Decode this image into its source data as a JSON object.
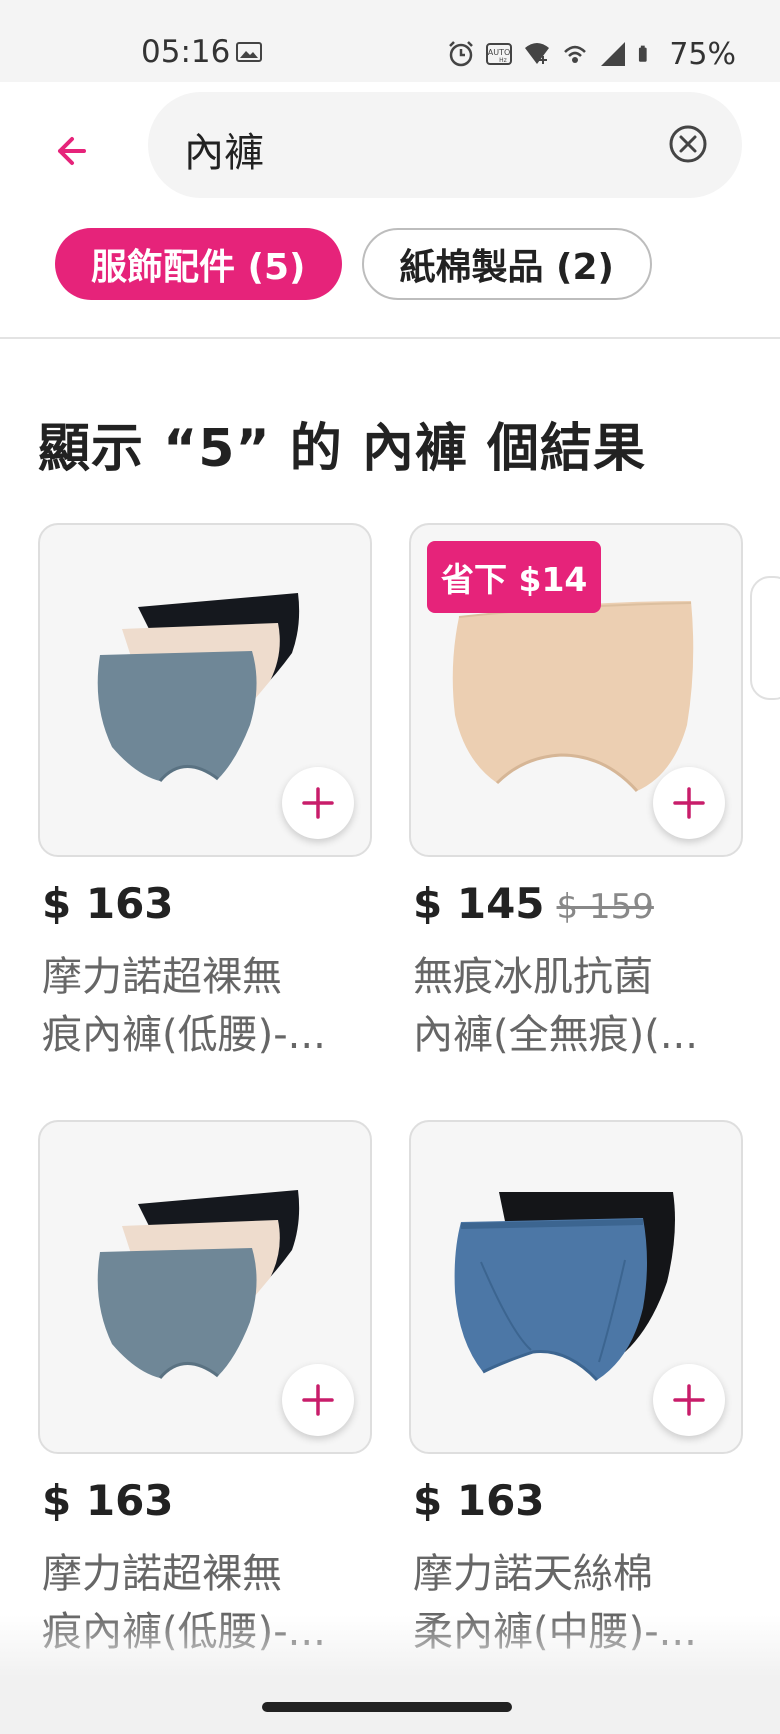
{
  "status_bar": {
    "time": "05:16",
    "battery": "75%",
    "icons": [
      "image-icon",
      "alarm-icon",
      "auto-hz-icon",
      "wifi-icon",
      "hotspot-icon",
      "signal-icon",
      "battery-icon"
    ]
  },
  "header": {
    "back_icon": "arrow-left-icon",
    "search_value": "內褲",
    "clear_icon": "clear-circle-icon"
  },
  "filters": [
    {
      "label": "服飾配件 (5)",
      "selected": true
    },
    {
      "label": "紙棉製品 (2)",
      "selected": false
    }
  ],
  "results_title": "顯示 “5” 的 內褲 個結果",
  "products": [
    {
      "price": "$ 163",
      "original_price": "",
      "badge": "",
      "name_line1": "摩力諾超裸無",
      "name_line2": "痕內褲(低腰)-..."
    },
    {
      "price": "$ 145",
      "original_price": "$ 159",
      "badge": "省下 $14",
      "name_line1": "無痕冰肌抗菌",
      "name_line2": "內褲(全無痕)(..."
    },
    {
      "price": "$ 163",
      "original_price": "",
      "badge": "",
      "name_line1": "摩力諾超裸無",
      "name_line2": "痕內褲(低腰)-..."
    },
    {
      "price": "$ 163",
      "original_price": "",
      "badge": "",
      "name_line1": "摩力諾天絲棉",
      "name_line2": "柔內褲(中腰)-..."
    }
  ],
  "colors": {
    "accent": "#e6237a",
    "text": "#222222",
    "muted": "#666666"
  }
}
